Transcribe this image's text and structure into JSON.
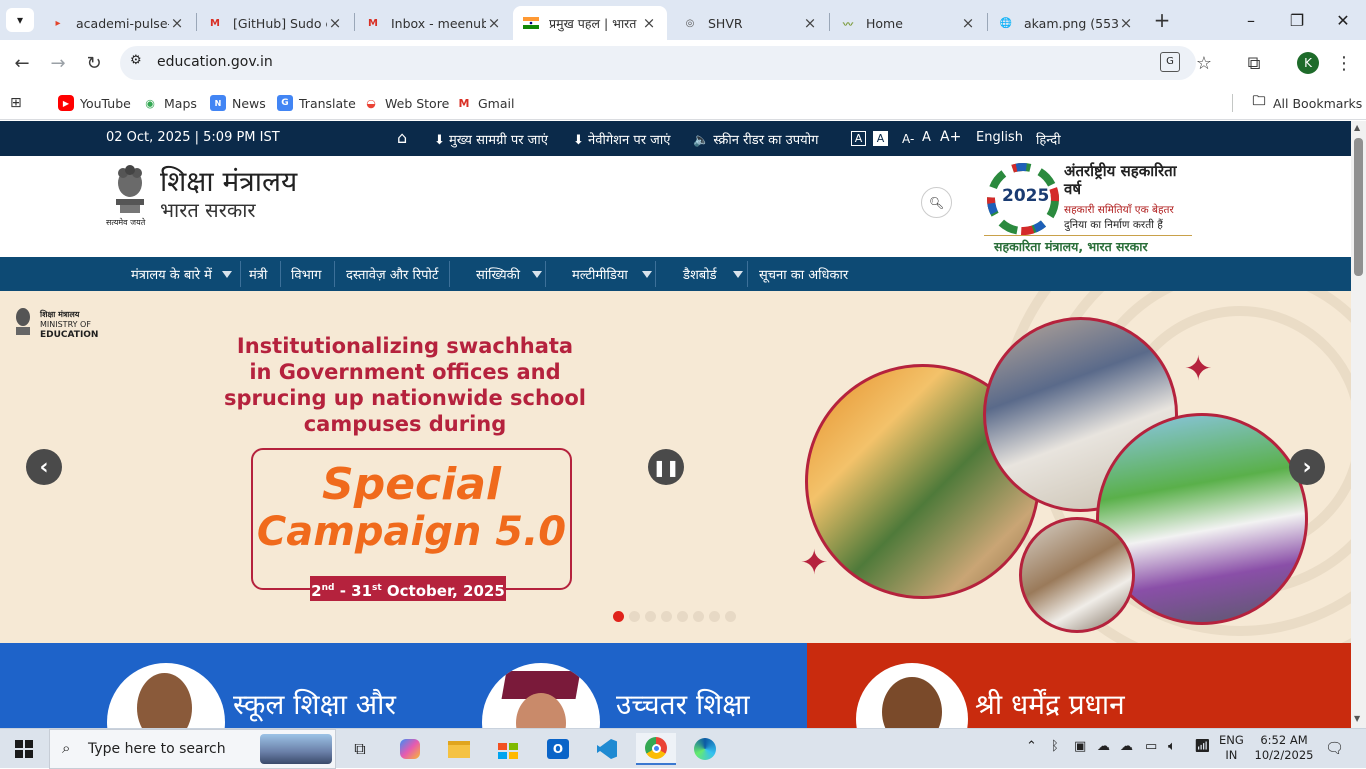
{
  "browser": {
    "tabs": [
      {
        "title": "academi-pulse-a",
        "icon": "gitlab-icon"
      },
      {
        "title": "[GitHub] Sudo e",
        "icon": "gmail-icon"
      },
      {
        "title": "Inbox - meenub",
        "icon": "gmail-icon"
      },
      {
        "title": "प्रमुख पहल | भारत",
        "icon": "india-flag-icon",
        "active": true
      },
      {
        "title": "SHVR",
        "icon": "globe-icon"
      },
      {
        "title": "Home",
        "icon": "home-favicon"
      },
      {
        "title": "akam.png (553×",
        "icon": "globe-icon"
      }
    ],
    "url": "education.gov.in",
    "profile_initial": "K",
    "bookmarks": [
      {
        "label": "YouTube",
        "icon": "youtube-icon"
      },
      {
        "label": "Maps",
        "icon": "maps-icon"
      },
      {
        "label": "News",
        "icon": "news-icon"
      },
      {
        "label": "Translate",
        "icon": "translate-icon"
      },
      {
        "label": "Web Store",
        "icon": "webstore-icon"
      },
      {
        "label": "Gmail",
        "icon": "gmail-icon"
      }
    ],
    "all_bookmarks": "All Bookmarks"
  },
  "site": {
    "topbar": {
      "datetime": "02 Oct, 2025 | 5:09 PM IST",
      "skip_main": "मुख्य सामग्री पर जाएं",
      "skip_nav": "नेवीगेशन पर जाएं",
      "screen_reader": "स्क्रीन रीडर का उपयोग",
      "text_a1": "A",
      "text_a2": "A",
      "font_minus": "A-",
      "font_normal": "A",
      "font_plus": "A+",
      "lang_en": "English",
      "lang_hi": "हिन्दी"
    },
    "header": {
      "ministry": "शिक्षा मंत्रालय",
      "govt": "भारत सरकार",
      "emblem_motto": "सत्यमेव जयते",
      "coop_title": "अंतर्राष्ट्रीय सहकारिता वर्ष",
      "coop_year": "2025",
      "coop_tagline_1": "सहकारी समितियाँ एक बेहतर",
      "coop_tagline_2": "दुनिया का निर्माण करती हैं",
      "coop_ministry": "सहकारिता मंत्रालय, भारत सरकार"
    },
    "nav": [
      {
        "label": "मंत्रालय के बारे में",
        "dropdown": true
      },
      {
        "label": "मंत्री",
        "dropdown": false
      },
      {
        "label": "विभाग",
        "dropdown": false
      },
      {
        "label": "दस्तावेज़ और रिपोर्ट",
        "dropdown": false
      },
      {
        "label": "सांख्यिकी",
        "dropdown": true
      },
      {
        "label": "मल्टीमीडिया",
        "dropdown": true
      },
      {
        "label": "डैशबोर्ड",
        "dropdown": true
      },
      {
        "label": "सूचना का अधिकार",
        "dropdown": false
      }
    ],
    "slide": {
      "logo_hi": "शिक्षा मंत्रालय",
      "logo_en_1": "MINISTRY OF",
      "logo_en_2": "EDUCATION",
      "headline_1": "Institutionalizing swachhata",
      "headline_2": "in Government offices and",
      "headline_3": "sprucing up nationwide school",
      "headline_4": "campuses during",
      "campaign_1": "Special",
      "campaign_2": "Campaign 5.0",
      "dates_day1": "2",
      "dates_sup1": "nd",
      "dates_mid": " - 31",
      "dates_sup2": "st",
      "dates_tail": " October, 2025",
      "dot_count": 8,
      "active_dot": 0
    },
    "cards": [
      {
        "title": "स्कूल शिक्षा और",
        "color": "#1e63c9"
      },
      {
        "title": "उच्चतर शिक्षा",
        "color": "#1e63c9"
      },
      {
        "title": "श्री धर्मेंद्र प्रधान",
        "color": "#c92b0e"
      }
    ]
  },
  "taskbar": {
    "search_placeholder": "Type here to search",
    "lang": "ENG",
    "region": "IN",
    "time": "6:52 AM",
    "date": "10/2/2025"
  },
  "colors": {
    "topbar": "#0b2a4a",
    "nav": "#0d4a74",
    "headline": "#b5223d",
    "campaign": "#f06a1c"
  }
}
